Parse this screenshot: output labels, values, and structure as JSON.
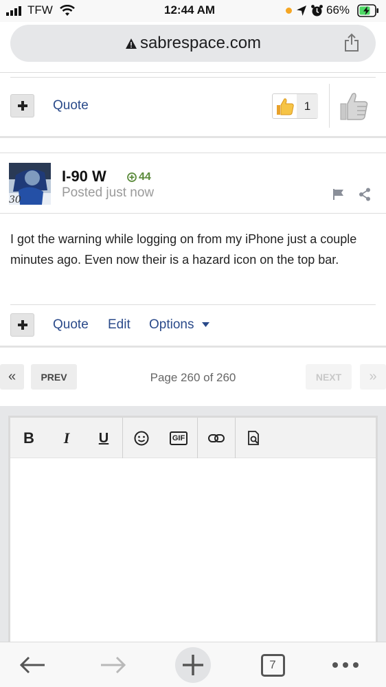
{
  "status_bar": {
    "carrier": "TFW",
    "time": "12:44 AM",
    "battery": "66%"
  },
  "browser": {
    "url": "sabrespace.com",
    "tab_count": "7"
  },
  "prev_post": {
    "quote_label": "Quote",
    "reaction_count": "1"
  },
  "post": {
    "author": "I-90 W",
    "reputation": "44",
    "posted": "Posted just now",
    "avatar_number": "30",
    "body": "I got the warning while logging on from my iPhone just a couple minutes ago. Even now their is a hazard icon on the top bar.",
    "actions": {
      "quote": "Quote",
      "edit": "Edit",
      "options": "Options"
    }
  },
  "pagination": {
    "first": "«",
    "prev": "PREV",
    "page_info": "Page 260 of 260",
    "next": "NEXT",
    "last": "»"
  },
  "editor": {
    "bold": "B",
    "italic": "I",
    "underline": "U",
    "gif": "GIF"
  },
  "colors": {
    "link": "#2a4a8a",
    "rep_green": "#5a8a3a",
    "battery_green": "#4cd964",
    "location_orange": "#f5a623"
  },
  "icons": [
    "signal-icon",
    "wifi-icon",
    "location-icon",
    "alarm-icon",
    "battery-icon",
    "lock-warning-icon",
    "share-icon",
    "plus-icon",
    "thumbs-up-icon",
    "like-icon",
    "flag-icon",
    "share-post-icon",
    "caret-down-icon",
    "emoji-icon",
    "link-icon",
    "preview-icon",
    "back-icon",
    "forward-icon",
    "new-tab-icon",
    "tabs-icon",
    "more-icon"
  ]
}
